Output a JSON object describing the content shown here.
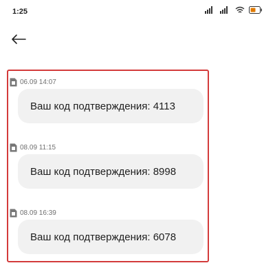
{
  "status_bar": {
    "time": "1:25",
    "icons": [
      "signal-icon",
      "signal-icon",
      "wifi-icon",
      "battery-icon"
    ]
  },
  "header": {
    "back_icon": "arrow-left-icon"
  },
  "messages": [
    {
      "sim_icon": "sim-card-icon",
      "date": "06.09 14:07",
      "text": "Ваш код подтверждения: 4113"
    },
    {
      "sim_icon": "sim-card-icon",
      "date": "08.09 11:15",
      "text": "Ваш код подтверждения: 8998"
    },
    {
      "sim_icon": "sim-card-icon",
      "date": "08.09 16:39",
      "text": "Ваш код подтверждения: 6078"
    }
  ],
  "colors": {
    "highlight_border": "#d33a3a",
    "bubble_background": "#f1f1f1"
  }
}
